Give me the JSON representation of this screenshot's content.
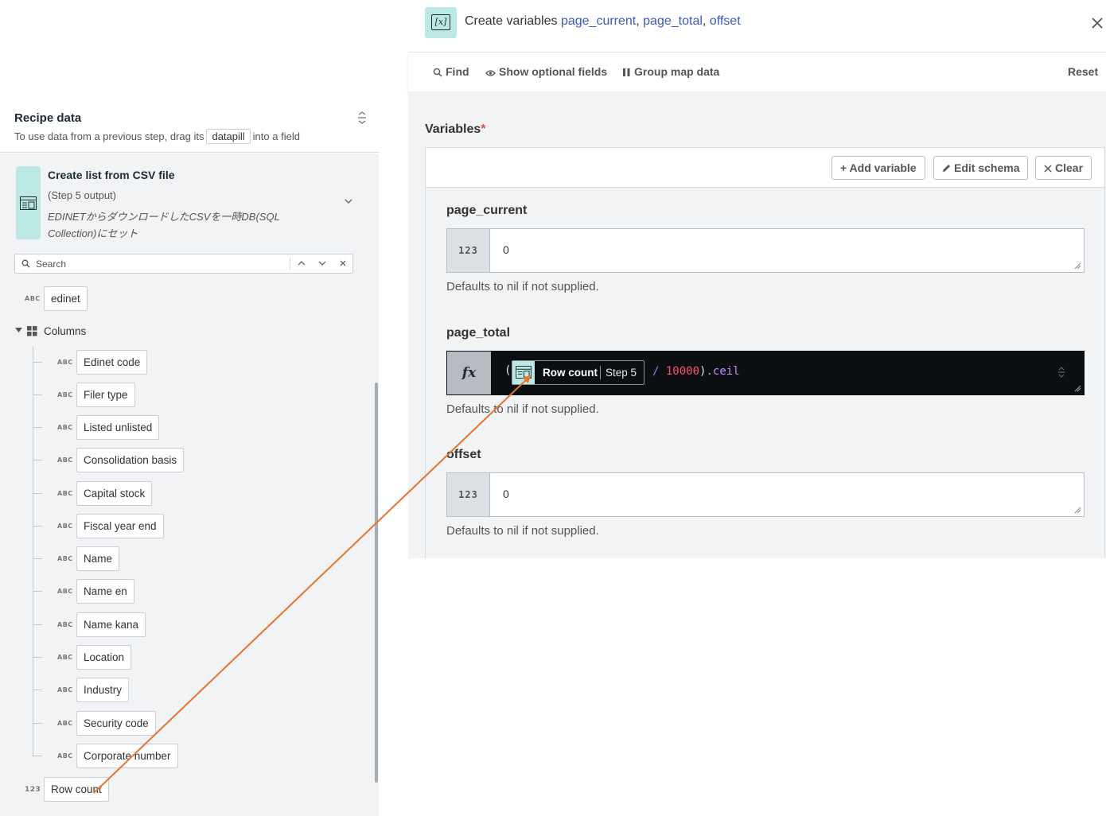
{
  "left": {
    "title": "Recipe data",
    "subtitle_before": "To use data from a previous step, drag its",
    "subtitle_pill": "datapill",
    "subtitle_after": "into a field",
    "step": {
      "title": "Create list from CSV file",
      "sub": "(Step 5 output)",
      "desc": "EDINETからダウンロードしたCSVを一時DB(SQL Collection)にセット"
    },
    "search": {
      "placeholder": "Search"
    },
    "top_pill": {
      "type": "ABC",
      "label": "edinet"
    },
    "columns_label": "Columns",
    "columns": [
      {
        "type": "ABC",
        "label": "Edinet code"
      },
      {
        "type": "ABC",
        "label": "Filer type"
      },
      {
        "type": "ABC",
        "label": "Listed unlisted"
      },
      {
        "type": "ABC",
        "label": "Consolidation basis"
      },
      {
        "type": "ABC",
        "label": "Capital stock"
      },
      {
        "type": "ABC",
        "label": "Fiscal year end"
      },
      {
        "type": "ABC",
        "label": "Name"
      },
      {
        "type": "ABC",
        "label": "Name en"
      },
      {
        "type": "ABC",
        "label": "Name kana"
      },
      {
        "type": "ABC",
        "label": "Location"
      },
      {
        "type": "ABC",
        "label": "Industry"
      },
      {
        "type": "ABC",
        "label": "Security code"
      },
      {
        "type": "ABC",
        "label": "Corporate number"
      }
    ],
    "row_count": {
      "type": "123",
      "label": "Row count"
    }
  },
  "right": {
    "header": {
      "prefix": "Create variables",
      "var1": "page_current",
      "var2": "page_total",
      "var3": "offset",
      "sep": ", "
    },
    "toolbar": {
      "find": "Find",
      "show_optional": "Show optional fields",
      "group_map": "Group map data",
      "reset": "Reset"
    },
    "variables_label": "Variables",
    "required_mark": "*",
    "buttons": {
      "add": "+ Add variable",
      "edit": "Edit schema",
      "clear": "Clear"
    },
    "fields": {
      "page_current": {
        "label": "page_current",
        "type": "123",
        "value": "0",
        "help": "Defaults to nil if not supplied."
      },
      "page_total": {
        "label": "page_total",
        "type": "fx",
        "open_paren": "(",
        "pill_label": "Row count",
        "pill_step": "Step 5",
        "op": "/",
        "num": "10000",
        "close": ")",
        "method": ".ceil",
        "help": "Defaults to nil if not supplied."
      },
      "offset": {
        "label": "offset",
        "type": "123",
        "value": "0",
        "help": "Defaults to nil if not supplied."
      }
    }
  },
  "colors": {
    "accent": "#bde9e4",
    "link": "#3b5bbd",
    "arrow": "#e8732e",
    "formula_bg": "#0c0f12"
  }
}
